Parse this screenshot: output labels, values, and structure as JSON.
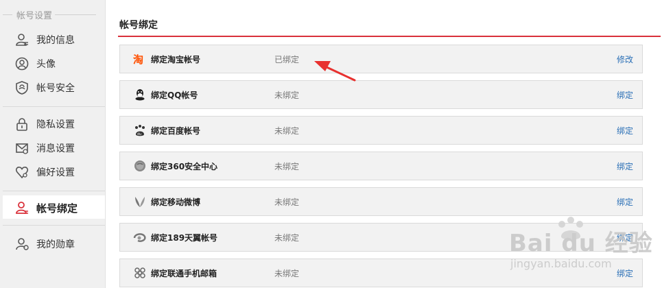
{
  "sidebar": {
    "section_title": "帐号设置",
    "items": [
      {
        "label": "我的信息",
        "icon": "user-icon"
      },
      {
        "label": "头像",
        "icon": "avatar-icon"
      },
      {
        "label": "帐号安全",
        "icon": "shield-icon"
      },
      {
        "label": "隐私设置",
        "icon": "lock-icon"
      },
      {
        "label": "消息设置",
        "icon": "mail-icon"
      },
      {
        "label": "偏好设置",
        "icon": "heart-icon"
      },
      {
        "label": "帐号绑定",
        "icon": "user-bind-icon",
        "active": true
      },
      {
        "label": "我的勋章",
        "icon": "medal-user-icon"
      }
    ]
  },
  "main": {
    "title": "帐号绑定",
    "bindings": [
      {
        "name": "绑定淘宝帐号",
        "status": "已绑定",
        "action": "修改",
        "icon": "taobao-icon"
      },
      {
        "name": "绑定QQ帐号",
        "status": "未绑定",
        "action": "绑定",
        "icon": "qq-icon"
      },
      {
        "name": "绑定百度帐号",
        "status": "未绑定",
        "action": "绑定",
        "icon": "baidu-paw-icon"
      },
      {
        "name": "绑定360安全中心",
        "status": "未绑定",
        "action": "绑定",
        "icon": "360-icon"
      },
      {
        "name": "绑定移动微博",
        "status": "未绑定",
        "action": "绑定",
        "icon": "mobile-weibo-icon"
      },
      {
        "name": "绑定189天翼帐号",
        "status": "未绑定",
        "action": "绑定",
        "icon": "tianyi-icon"
      },
      {
        "name": "绑定联通手机邮箱",
        "status": "未绑定",
        "action": "绑定",
        "icon": "unicom-icon"
      }
    ]
  },
  "watermark": {
    "main": "Bai du 经验",
    "sub": "jingyan.baidu.com"
  },
  "colors": {
    "accent_red": "#d9303a",
    "link_blue": "#2a6fb6",
    "taobao_orange": "#ff5000",
    "arrow_red": "#e8312f"
  }
}
